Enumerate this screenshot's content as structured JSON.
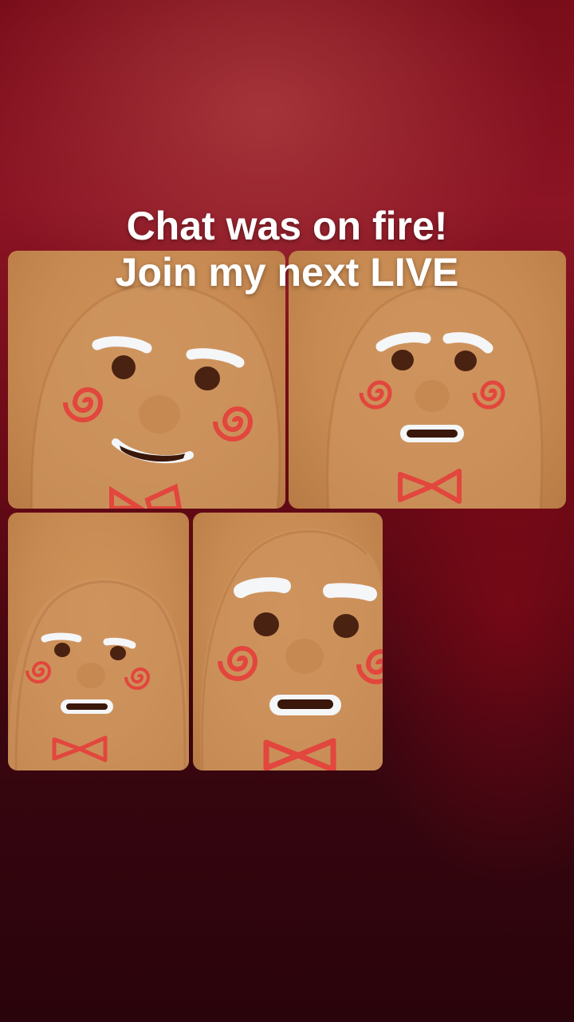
{
  "overlay": {
    "line1": "Chat was on fire!",
    "line2": "Join my next LIVE"
  },
  "tiles": [
    {
      "name": "participant-tile-1",
      "expression": "smiling"
    },
    {
      "name": "participant-tile-2",
      "expression": "grimace"
    },
    {
      "name": "participant-tile-3",
      "expression": "grimace-small"
    },
    {
      "name": "participant-tile-4",
      "expression": "grimace-closeup"
    }
  ],
  "colors": {
    "background_top": "#8c1424",
    "background_bottom": "#2a040b",
    "cookie": "#c78a52",
    "icing_white": "#f4f6f8",
    "icing_red": "#e2463d",
    "eye": "#4a2212"
  }
}
